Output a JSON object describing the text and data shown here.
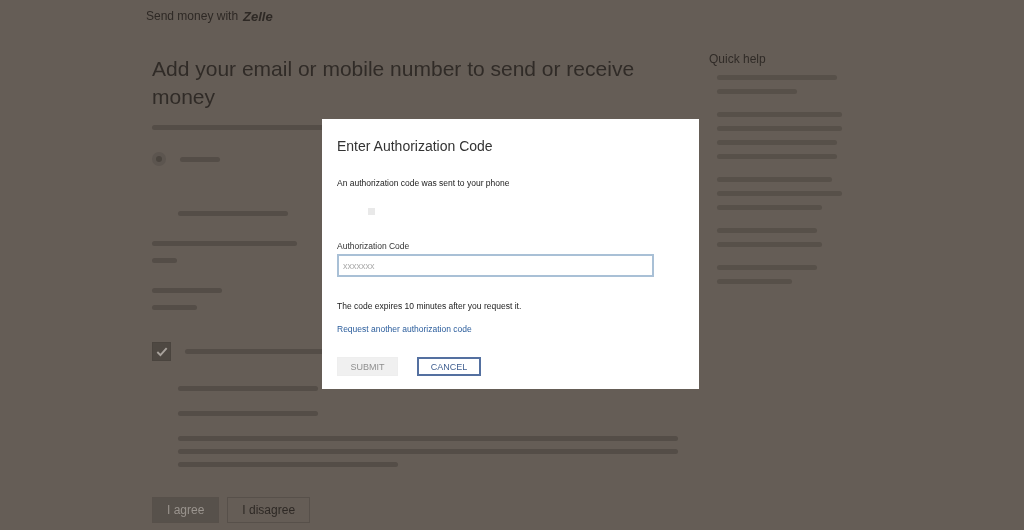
{
  "header": {
    "text": "Send money with",
    "brand": "Zelle"
  },
  "heading": "Add your email or mobile number to send or receive money",
  "contact_option": {
    "selected": true
  },
  "consent": {
    "checked": true
  },
  "buttons": [
    {
      "label": "I agree",
      "kind": "primary"
    },
    {
      "label": "I disagree",
      "kind": "secondary"
    }
  ],
  "quick_help": {
    "title": "Quick help"
  },
  "dialog": {
    "title": "Enter Authorization Code",
    "message": "An authorization code was sent to your phone",
    "field": {
      "label": "Authorization Code",
      "placeholder": "xxxxxxx"
    },
    "note": "The code expires 10 minutes after you request it.",
    "link": "Request another authorization code",
    "buttons": [
      {
        "label": "SUBMIT",
        "disabled": true
      },
      {
        "label": "CANCEL",
        "disabled": false
      }
    ]
  }
}
